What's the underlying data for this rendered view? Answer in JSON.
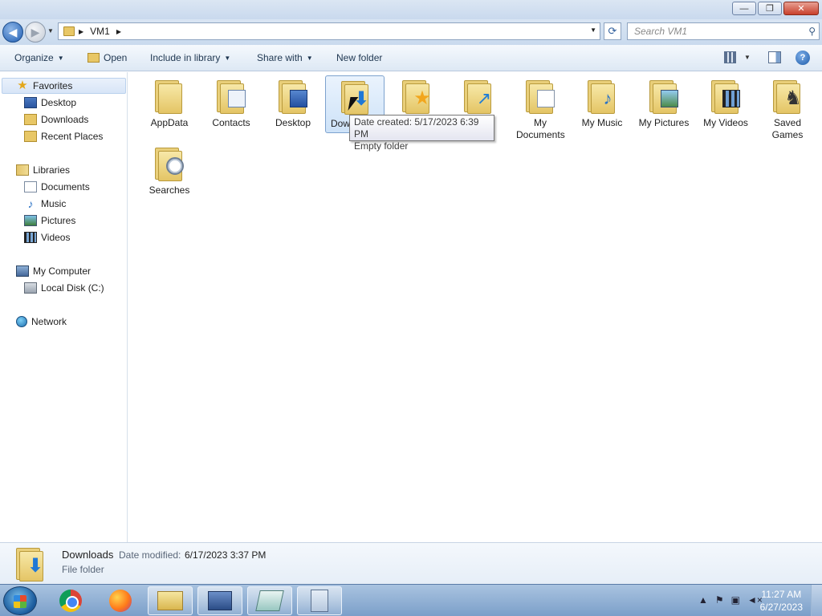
{
  "window": {
    "minimize": "—",
    "maximize": "❐",
    "close": "✕"
  },
  "address": {
    "crumb": "VM1",
    "search_placeholder": "Search VM1"
  },
  "command_bar": {
    "organize": "Organize",
    "open": "Open",
    "include_in_library": "Include in library",
    "share_with": "Share with",
    "new_folder": "New folder"
  },
  "nav": {
    "favorites": "Favorites",
    "desktop": "Desktop",
    "downloads": "Downloads",
    "recent_places": "Recent Places",
    "libraries": "Libraries",
    "documents": "Documents",
    "music": "Music",
    "pictures": "Pictures",
    "videos": "Videos",
    "my_computer": "My Computer",
    "local_disk": "Local Disk (C:)",
    "network": "Network"
  },
  "folders": [
    {
      "label": "AppData"
    },
    {
      "label": "Contacts"
    },
    {
      "label": "Desktop"
    },
    {
      "label": "Dow"
    },
    {
      "label": ""
    },
    {
      "label": ""
    },
    {
      "label": "My Documents"
    },
    {
      "label": "My Music"
    },
    {
      "label": "My Pictures"
    },
    {
      "label": "My Videos"
    },
    {
      "label": "Saved Games"
    },
    {
      "label": "Searches"
    }
  ],
  "tooltip": {
    "line1": "Date created: 5/17/2023 6:39 PM",
    "line2": "Empty folder"
  },
  "details": {
    "name": "Downloads",
    "modified_label": "Date modified:",
    "modified_value": "6/17/2023 3:37 PM",
    "type": "File folder"
  },
  "taskbar": {
    "time": "11:27 AM",
    "date": "6/27/2023"
  }
}
